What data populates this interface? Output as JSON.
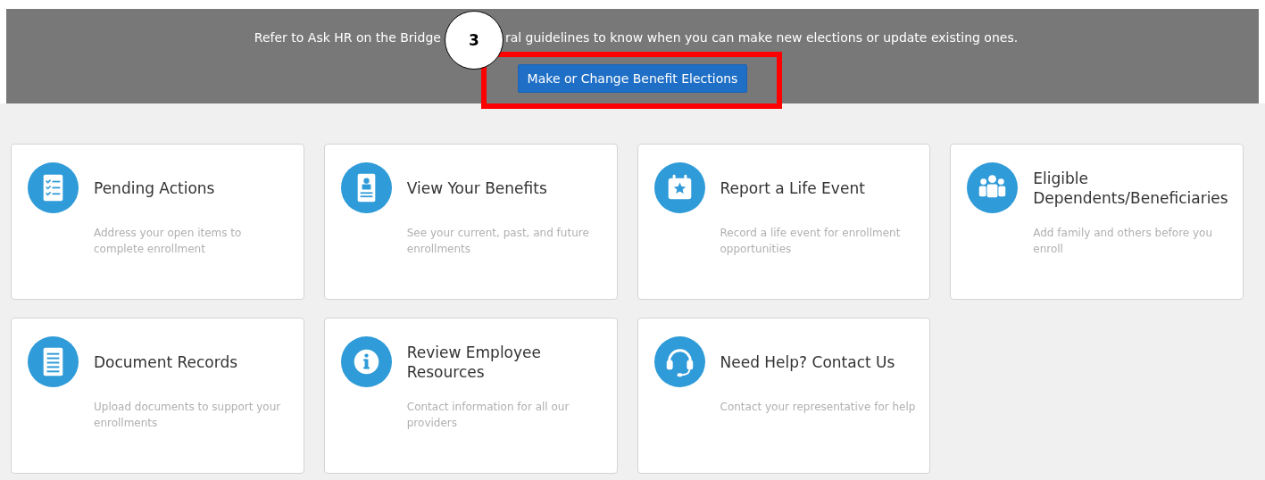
{
  "banner": {
    "message_before": "Refer to Ask HR on the Bridge",
    "message_after": "ral guidelines to know when you can make new elections or update existing ones.",
    "button": "Make or Change Benefit Elections"
  },
  "callout": {
    "number": "3"
  },
  "cards": [
    {
      "title": "Pending Actions",
      "description": "Address your open items to complete enrollment"
    },
    {
      "title": "View Your Benefits",
      "description": "See your current, past, and future enrollments"
    },
    {
      "title": "Report a Life Event",
      "description": "Record a life event for enrollment opportunities"
    },
    {
      "title": "Eligible Dependents/Beneficiaries",
      "description": "Add family and others before you enroll"
    },
    {
      "title": "Document Records",
      "description": "Upload documents to support your enrollments"
    },
    {
      "title": "Review Employee Resources",
      "description": "Contact information for all our providers"
    },
    {
      "title": "Need Help? Contact Us",
      "description": "Contact your representative for help"
    }
  ]
}
